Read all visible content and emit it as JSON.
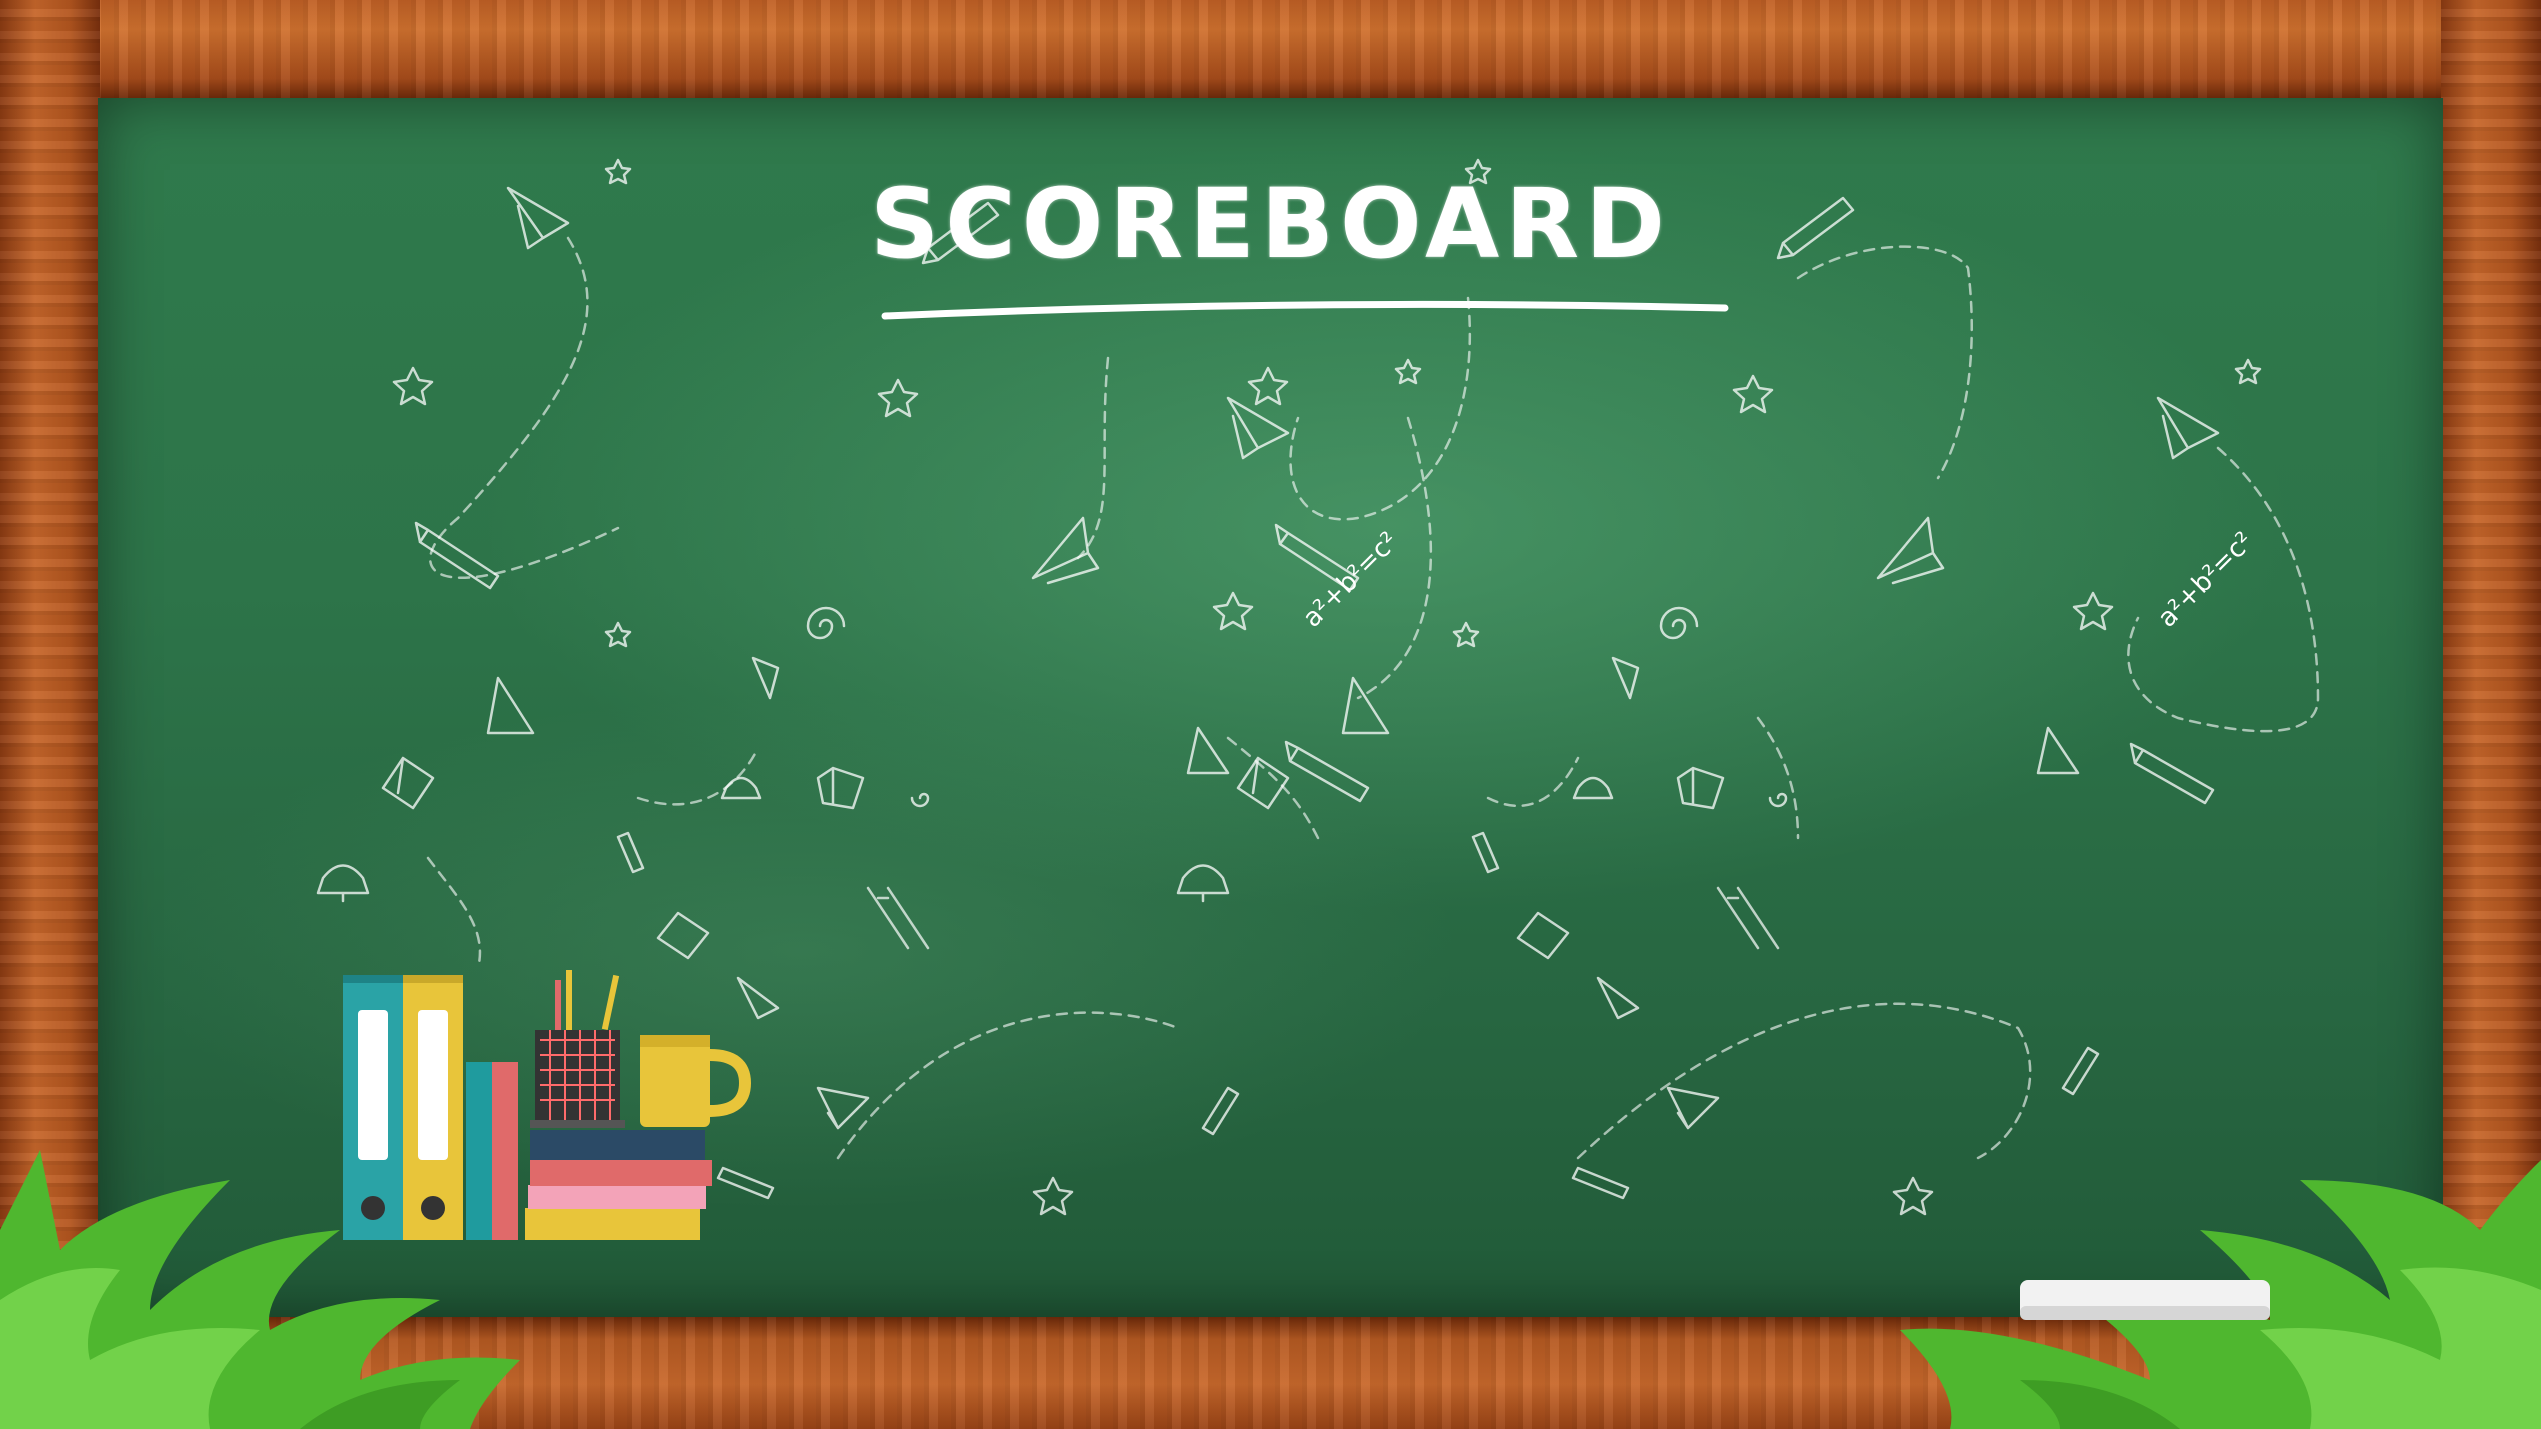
{
  "board": {
    "title": "SCOREBOARD",
    "chalk_formulas": [
      "a²+b²=c²",
      "a²+b²=c²"
    ]
  },
  "colors": {
    "chalkboard": "#2d7449",
    "wood_frame": "#b4561f",
    "chalk": "#ffffff",
    "grass": "#5cc23a"
  },
  "icons": {
    "paper_plane": "paper-plane-icon",
    "pencil": "pencil-icon",
    "star": "star-icon",
    "book": "book-icon",
    "spiral": "spiral-icon",
    "bell": "bell-icon",
    "binder": "binder-icon",
    "pencil_cup": "pencil-cup-icon",
    "mug": "mug-icon",
    "grass": "grass-icon",
    "eraser": "chalk-eraser-icon"
  }
}
